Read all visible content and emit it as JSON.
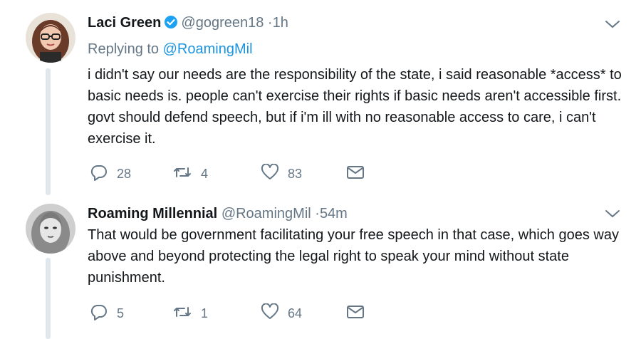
{
  "tweets": [
    {
      "name": "Laci Green",
      "verified": true,
      "handle": "@gogreen18",
      "time": "1h",
      "replying_label": "Replying to",
      "replying_to": "@RoamingMil",
      "text": "i didn't say our needs are the responsibility of the state, i said reasonable *access* to basic needs is. people can't exercise their rights if basic needs aren't accessible first.  govt should defend speech, but if i'm ill with no reasonable access to care, i can't exercise it.",
      "replies": "28",
      "retweets": "4",
      "likes": "83"
    },
    {
      "name": "Roaming Millennial",
      "verified": false,
      "handle": "@RoamingMil",
      "time": "54m",
      "text": "That would be government facilitating your free speech in that case, which goes way above and beyond protecting the legal right to speak your mind without state punishment.",
      "replies": "5",
      "retweets": "1",
      "likes": "64"
    }
  ],
  "separator": "·",
  "icons": {
    "reply": "reply-icon",
    "retweet": "retweet-icon",
    "like": "heart-icon",
    "dm": "envelope-icon",
    "menu": "chevron-down-icon",
    "verified": "verified-badge-icon"
  },
  "colors": {
    "text": "#14171a",
    "secondary": "#657786",
    "link": "#1b95e0",
    "verified": "#1da1f2",
    "thread_line": "#e1e8ed"
  }
}
